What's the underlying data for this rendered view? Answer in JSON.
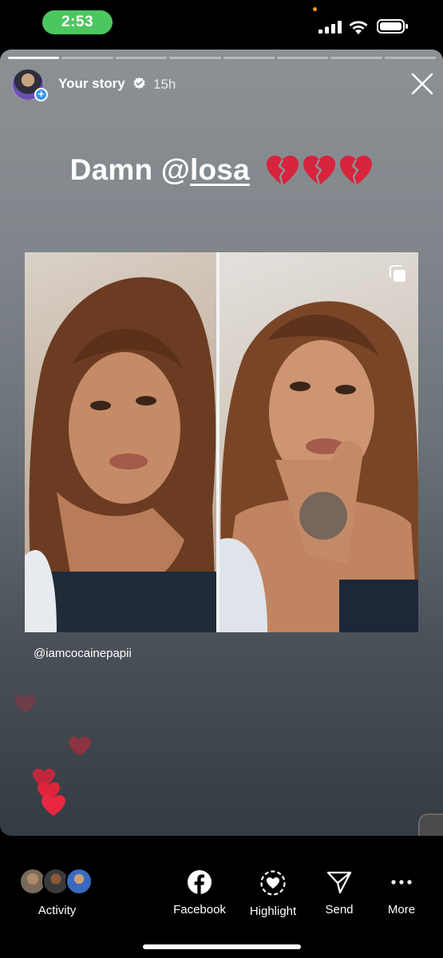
{
  "status_bar": {
    "time": "2:53",
    "time_pill_color": "#4cc760"
  },
  "story": {
    "progress_segments_total": 8,
    "progress_segments_done": 1,
    "user": "Your story",
    "time": "15h",
    "caption_text": "Damn @",
    "caption_mention": "losa",
    "caption_emoji": "broken-heart-icon",
    "post_author": "@iamcocainepapii"
  },
  "bottom_bar": {
    "activity_label": "Activity",
    "actions": [
      {
        "label": "Facebook",
        "icon": "facebook-icon"
      },
      {
        "label": "Highlight",
        "icon": "highlight-icon"
      },
      {
        "label": "Send",
        "icon": "send-icon"
      },
      {
        "label": "More",
        "icon": "more-icon"
      }
    ]
  },
  "colors": {
    "accent_blue": "#3797f0",
    "heart_red": "#e0243a"
  }
}
